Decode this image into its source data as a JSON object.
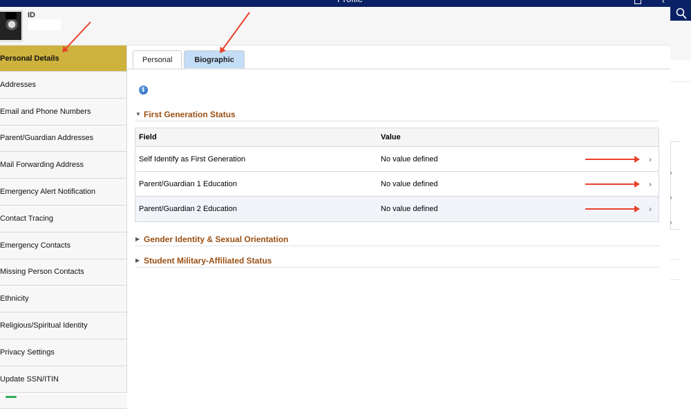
{
  "window": {
    "title": "Profile"
  },
  "header": {
    "id_label": "ID",
    "id_value": ""
  },
  "sidebar": {
    "items": [
      {
        "label": "Personal Details",
        "active": true
      },
      {
        "label": "Addresses"
      },
      {
        "label": "Email and Phone Numbers"
      },
      {
        "label": "Parent/Guardian Addresses"
      },
      {
        "label": "Mail Forwarding Address"
      },
      {
        "label": "Emergency Alert Notification"
      },
      {
        "label": "Contact Tracing"
      },
      {
        "label": "Emergency Contacts"
      },
      {
        "label": "Missing Person Contacts"
      },
      {
        "label": "Ethnicity"
      },
      {
        "label": "Religious/Spiritual Identity"
      },
      {
        "label": "Privacy Settings"
      },
      {
        "label": "Update SSN/ITIN"
      }
    ]
  },
  "tabs": [
    {
      "label": "Personal",
      "selected": false
    },
    {
      "label": "Biographic",
      "selected": true
    }
  ],
  "info_icon": "i",
  "sections": [
    {
      "title": "First Generation Status",
      "expanded": true,
      "columns": [
        "Field",
        "Value"
      ],
      "rows": [
        {
          "field": "Self Identify as First Generation",
          "value": "No value defined"
        },
        {
          "field": "Parent/Guardian 1 Education",
          "value": "No value defined"
        },
        {
          "field": "Parent/Guardian 2 Education",
          "value": "No value defined"
        }
      ]
    },
    {
      "title": "Gender Identity & Sexual Orientation",
      "expanded": false
    },
    {
      "title": "Student Military-Affiliated Status",
      "expanded": false
    }
  ],
  "glyphs": {
    "expanded": "▼",
    "collapsed": "▶",
    "chevron": "›"
  },
  "colors": {
    "topbar": "#0b2165",
    "active_nav": "#cdb23e",
    "selected_tab": "#c4ddf6",
    "section_title": "#9a4f12",
    "annotation": "#e8412c"
  }
}
